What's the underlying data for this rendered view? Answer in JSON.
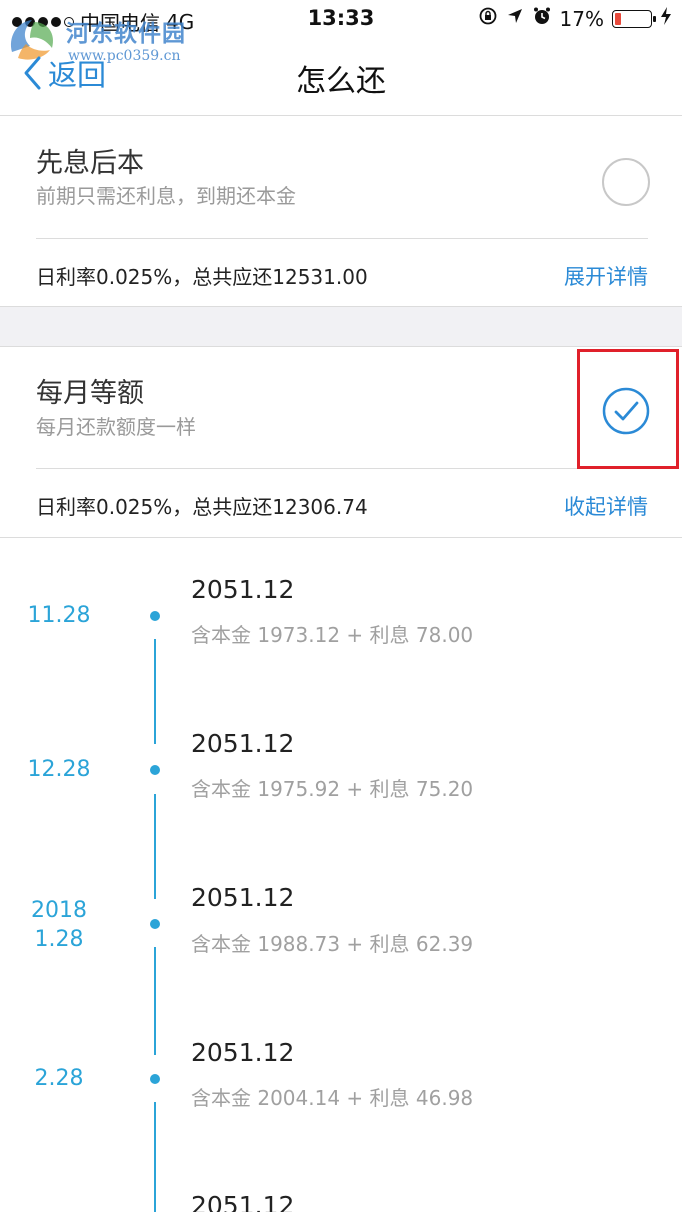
{
  "status_bar": {
    "carrier": "中国电信",
    "network": "4G",
    "time": "13:33",
    "battery_percent": "17%",
    "battery_level": 0.17,
    "icons": [
      "orientation-lock-icon",
      "location-arrow-icon",
      "alarm-icon",
      "charging-bolt-icon"
    ]
  },
  "watermark": {
    "name": "河东软件园",
    "url": "www.pc0359.cn"
  },
  "nav": {
    "back_label": "返回",
    "title": "怎么还"
  },
  "options": [
    {
      "title": "先息后本",
      "subtitle": "前期只需还利息，到期还本金",
      "summary": "日利率0.025%，总共应还12531.00",
      "detail_link": "展开详情",
      "selected": false
    },
    {
      "title": "每月等额",
      "subtitle": "每月还款额度一样",
      "summary": "日利率0.025%，总共应还12306.74",
      "detail_link": "收起详情",
      "selected": true
    }
  ],
  "schedule": [
    {
      "date_line1": "11.28",
      "date_line2": "",
      "amount": "2051.12",
      "detail": "含本金 1973.12 + 利息 78.00"
    },
    {
      "date_line1": "12.28",
      "date_line2": "",
      "amount": "2051.12",
      "detail": "含本金 1975.92 + 利息 75.20"
    },
    {
      "date_line1": "2018",
      "date_line2": "1.28",
      "amount": "2051.12",
      "detail": "含本金 1988.73 + 利息 62.39"
    },
    {
      "date_line1": "2.28",
      "date_line2": "",
      "amount": "2051.12",
      "detail": "含本金 2004.14 + 利息 46.98"
    },
    {
      "date_line1": "",
      "date_line2": "",
      "amount": "2051.12",
      "detail": ""
    }
  ],
  "colors": {
    "accent_blue": "#2b8ad6",
    "timeline_blue": "#2ba4d8",
    "highlight_red": "#e0202a",
    "battery_red": "#e84a3c"
  }
}
